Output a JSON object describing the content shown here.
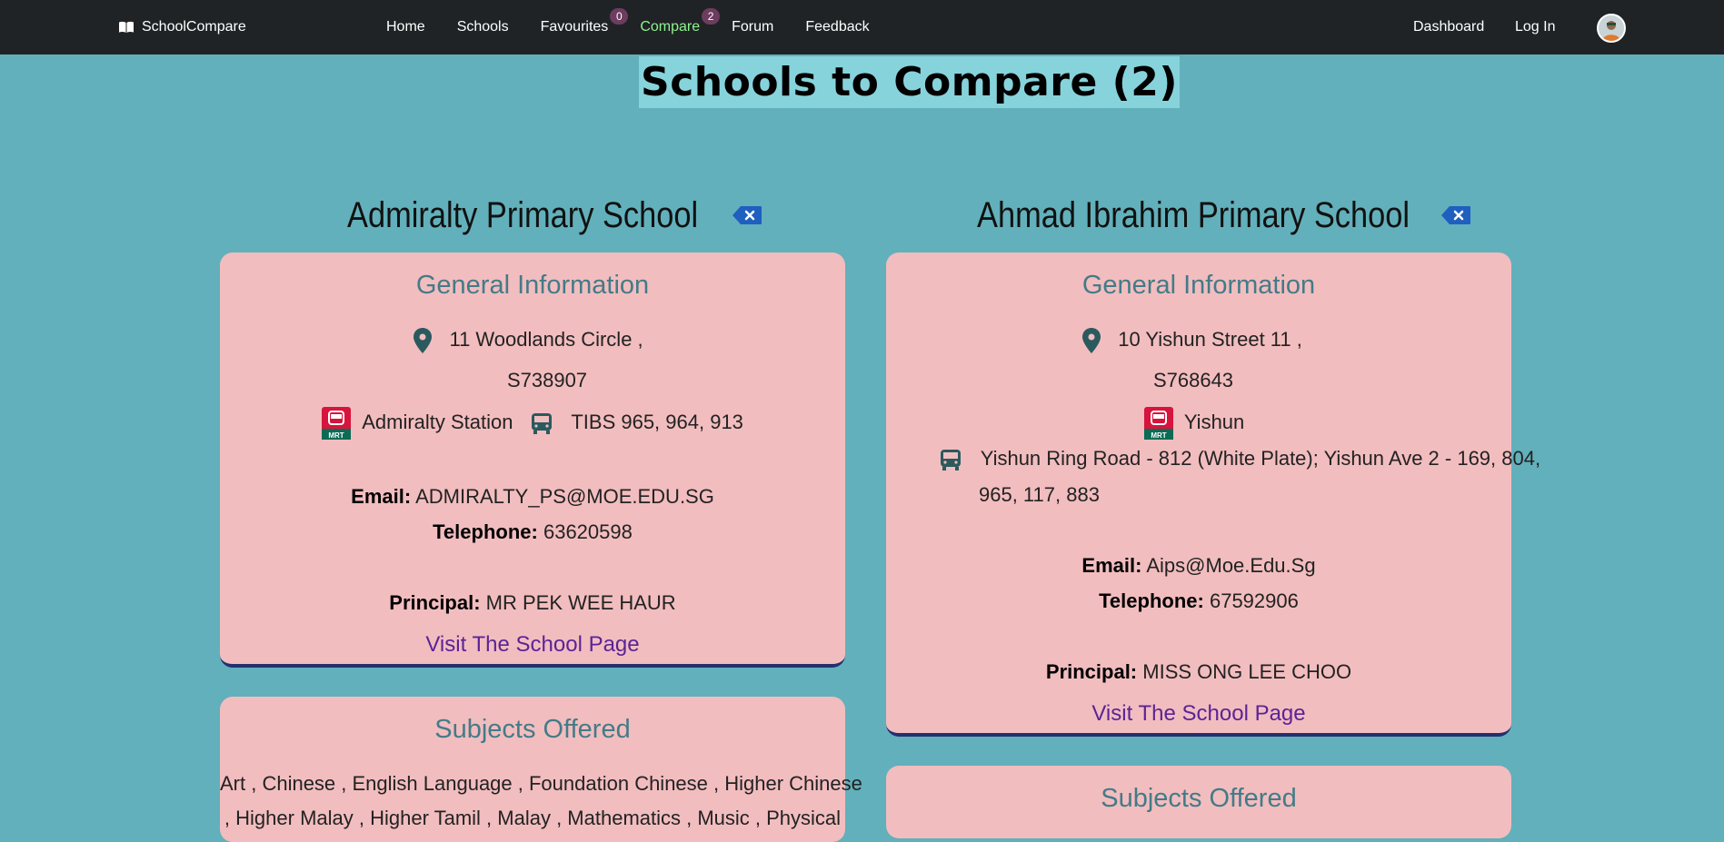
{
  "brand": {
    "name": "SchoolCompare"
  },
  "nav": {
    "home": "Home",
    "schools": "Schools",
    "favourites": "Favourites",
    "favourites_count": "0",
    "compare": "Compare",
    "compare_count": "2",
    "forum": "Forum",
    "feedback": "Feedback",
    "dashboard": "Dashboard",
    "login": "Log In"
  },
  "page_title": "Schools to Compare (2)",
  "schools": [
    {
      "name": "Admiralty Primary School",
      "general_title": "General Information",
      "address_line1": "11 Woodlands Circle ,",
      "address_line2": "S738907",
      "mrt": "Admiralty Station",
      "bus": "TIBS 965, 964, 913",
      "email_label": "Email:",
      "email": "ADMIRALTY_PS@MOE.EDU.SG",
      "telephone_label": "Telephone:",
      "telephone": "63620598",
      "principal_label": "Principal:",
      "principal": "MR PEK WEE HAUR",
      "visit_link": "Visit The School Page",
      "subjects_title": "Subjects Offered",
      "subjects_line1": "Art , Chinese , English Language , Foundation Chinese , Higher Chinese",
      "subjects_line2": ", Higher Malay , Higher Tamil , Malay , Mathematics , Music , Physical"
    },
    {
      "name": "Ahmad Ibrahim Primary School",
      "general_title": "General Information",
      "address_line1": "10 Yishun Street 11 ,",
      "address_line2": "S768643",
      "mrt": "Yishun",
      "bus_line1": "Yishun Ring Road - 812 (White Plate); Yishun Ave 2 - 169, 804,",
      "bus_line2": "965, 117, 883",
      "email_label": "Email:",
      "email": "Aips@Moe.Edu.Sg",
      "telephone_label": "Telephone:",
      "telephone": "67592906",
      "principal_label": "Principal:",
      "principal": "MISS ONG LEE CHOO",
      "visit_link": "Visit The School Page",
      "subjects_title": "Subjects Offered"
    }
  ],
  "colors": {
    "background": "#62b0bb",
    "navbar": "#1f2326",
    "card": "#f2bdbf",
    "card_title": "#437b88",
    "link": "#5a2496",
    "active_nav": "#8ef28e",
    "badge": "#6c3d5e",
    "remove_button": "#1f5fbf"
  },
  "icons": [
    "book-icon",
    "location-pin-icon",
    "mrt-icon",
    "bus-icon",
    "backspace-remove-icon",
    "user-avatar"
  ]
}
